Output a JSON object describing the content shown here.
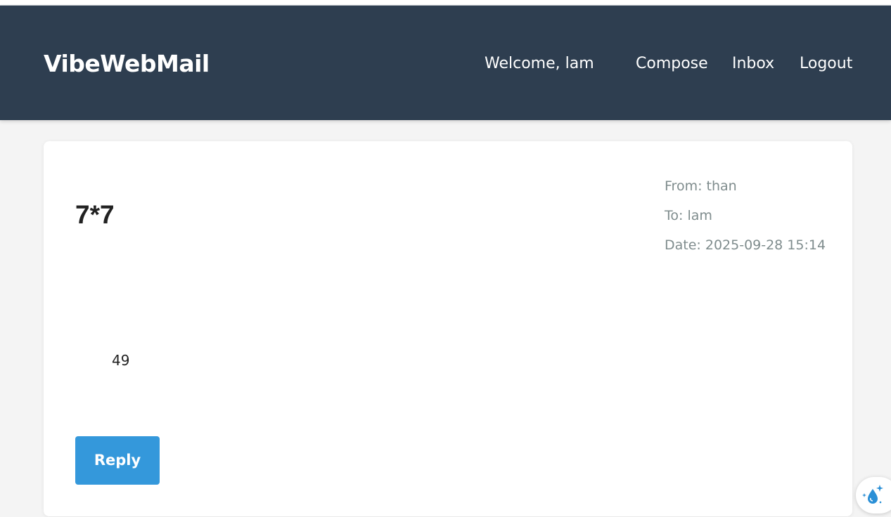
{
  "header": {
    "brand": "VibeWebMail",
    "welcome": "Welcome, lam",
    "nav": {
      "compose": "Compose",
      "inbox": "Inbox",
      "logout": "Logout"
    }
  },
  "email": {
    "subject": "7*7",
    "from": "From: than",
    "to": "To: lam",
    "date": "Date: 2025-09-28 15:14",
    "body": "49"
  },
  "actions": {
    "reply_label": "Reply"
  },
  "floating": {
    "icon": "sparkle-droplet-icon"
  },
  "colors": {
    "header_bg": "#2e3e50",
    "accent": "#3498db",
    "meta_text": "#7f8c8d",
    "page_bg": "#f4f4f4"
  }
}
